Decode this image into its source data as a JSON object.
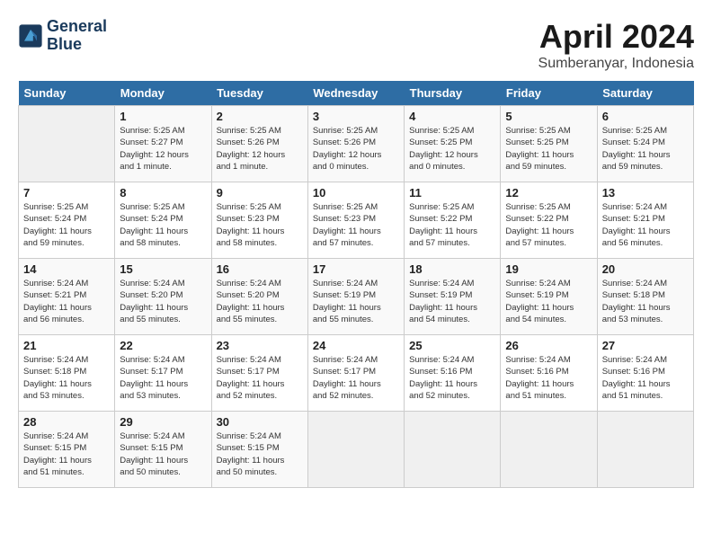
{
  "header": {
    "logo_line1": "General",
    "logo_line2": "Blue",
    "month": "April 2024",
    "location": "Sumberanyar, Indonesia"
  },
  "weekdays": [
    "Sunday",
    "Monday",
    "Tuesday",
    "Wednesday",
    "Thursday",
    "Friday",
    "Saturday"
  ],
  "weeks": [
    [
      {
        "day": "",
        "detail": ""
      },
      {
        "day": "1",
        "detail": "Sunrise: 5:25 AM\nSunset: 5:27 PM\nDaylight: 12 hours\nand 1 minute."
      },
      {
        "day": "2",
        "detail": "Sunrise: 5:25 AM\nSunset: 5:26 PM\nDaylight: 12 hours\nand 1 minute."
      },
      {
        "day": "3",
        "detail": "Sunrise: 5:25 AM\nSunset: 5:26 PM\nDaylight: 12 hours\nand 0 minutes."
      },
      {
        "day": "4",
        "detail": "Sunrise: 5:25 AM\nSunset: 5:25 PM\nDaylight: 12 hours\nand 0 minutes."
      },
      {
        "day": "5",
        "detail": "Sunrise: 5:25 AM\nSunset: 5:25 PM\nDaylight: 11 hours\nand 59 minutes."
      },
      {
        "day": "6",
        "detail": "Sunrise: 5:25 AM\nSunset: 5:24 PM\nDaylight: 11 hours\nand 59 minutes."
      }
    ],
    [
      {
        "day": "7",
        "detail": "Sunrise: 5:25 AM\nSunset: 5:24 PM\nDaylight: 11 hours\nand 59 minutes."
      },
      {
        "day": "8",
        "detail": "Sunrise: 5:25 AM\nSunset: 5:24 PM\nDaylight: 11 hours\nand 58 minutes."
      },
      {
        "day": "9",
        "detail": "Sunrise: 5:25 AM\nSunset: 5:23 PM\nDaylight: 11 hours\nand 58 minutes."
      },
      {
        "day": "10",
        "detail": "Sunrise: 5:25 AM\nSunset: 5:23 PM\nDaylight: 11 hours\nand 57 minutes."
      },
      {
        "day": "11",
        "detail": "Sunrise: 5:25 AM\nSunset: 5:22 PM\nDaylight: 11 hours\nand 57 minutes."
      },
      {
        "day": "12",
        "detail": "Sunrise: 5:25 AM\nSunset: 5:22 PM\nDaylight: 11 hours\nand 57 minutes."
      },
      {
        "day": "13",
        "detail": "Sunrise: 5:24 AM\nSunset: 5:21 PM\nDaylight: 11 hours\nand 56 minutes."
      }
    ],
    [
      {
        "day": "14",
        "detail": "Sunrise: 5:24 AM\nSunset: 5:21 PM\nDaylight: 11 hours\nand 56 minutes."
      },
      {
        "day": "15",
        "detail": "Sunrise: 5:24 AM\nSunset: 5:20 PM\nDaylight: 11 hours\nand 55 minutes."
      },
      {
        "day": "16",
        "detail": "Sunrise: 5:24 AM\nSunset: 5:20 PM\nDaylight: 11 hours\nand 55 minutes."
      },
      {
        "day": "17",
        "detail": "Sunrise: 5:24 AM\nSunset: 5:19 PM\nDaylight: 11 hours\nand 55 minutes."
      },
      {
        "day": "18",
        "detail": "Sunrise: 5:24 AM\nSunset: 5:19 PM\nDaylight: 11 hours\nand 54 minutes."
      },
      {
        "day": "19",
        "detail": "Sunrise: 5:24 AM\nSunset: 5:19 PM\nDaylight: 11 hours\nand 54 minutes."
      },
      {
        "day": "20",
        "detail": "Sunrise: 5:24 AM\nSunset: 5:18 PM\nDaylight: 11 hours\nand 53 minutes."
      }
    ],
    [
      {
        "day": "21",
        "detail": "Sunrise: 5:24 AM\nSunset: 5:18 PM\nDaylight: 11 hours\nand 53 minutes."
      },
      {
        "day": "22",
        "detail": "Sunrise: 5:24 AM\nSunset: 5:17 PM\nDaylight: 11 hours\nand 53 minutes."
      },
      {
        "day": "23",
        "detail": "Sunrise: 5:24 AM\nSunset: 5:17 PM\nDaylight: 11 hours\nand 52 minutes."
      },
      {
        "day": "24",
        "detail": "Sunrise: 5:24 AM\nSunset: 5:17 PM\nDaylight: 11 hours\nand 52 minutes."
      },
      {
        "day": "25",
        "detail": "Sunrise: 5:24 AM\nSunset: 5:16 PM\nDaylight: 11 hours\nand 52 minutes."
      },
      {
        "day": "26",
        "detail": "Sunrise: 5:24 AM\nSunset: 5:16 PM\nDaylight: 11 hours\nand 51 minutes."
      },
      {
        "day": "27",
        "detail": "Sunrise: 5:24 AM\nSunset: 5:16 PM\nDaylight: 11 hours\nand 51 minutes."
      }
    ],
    [
      {
        "day": "28",
        "detail": "Sunrise: 5:24 AM\nSunset: 5:15 PM\nDaylight: 11 hours\nand 51 minutes."
      },
      {
        "day": "29",
        "detail": "Sunrise: 5:24 AM\nSunset: 5:15 PM\nDaylight: 11 hours\nand 50 minutes."
      },
      {
        "day": "30",
        "detail": "Sunrise: 5:24 AM\nSunset: 5:15 PM\nDaylight: 11 hours\nand 50 minutes."
      },
      {
        "day": "",
        "detail": ""
      },
      {
        "day": "",
        "detail": ""
      },
      {
        "day": "",
        "detail": ""
      },
      {
        "day": "",
        "detail": ""
      }
    ]
  ]
}
